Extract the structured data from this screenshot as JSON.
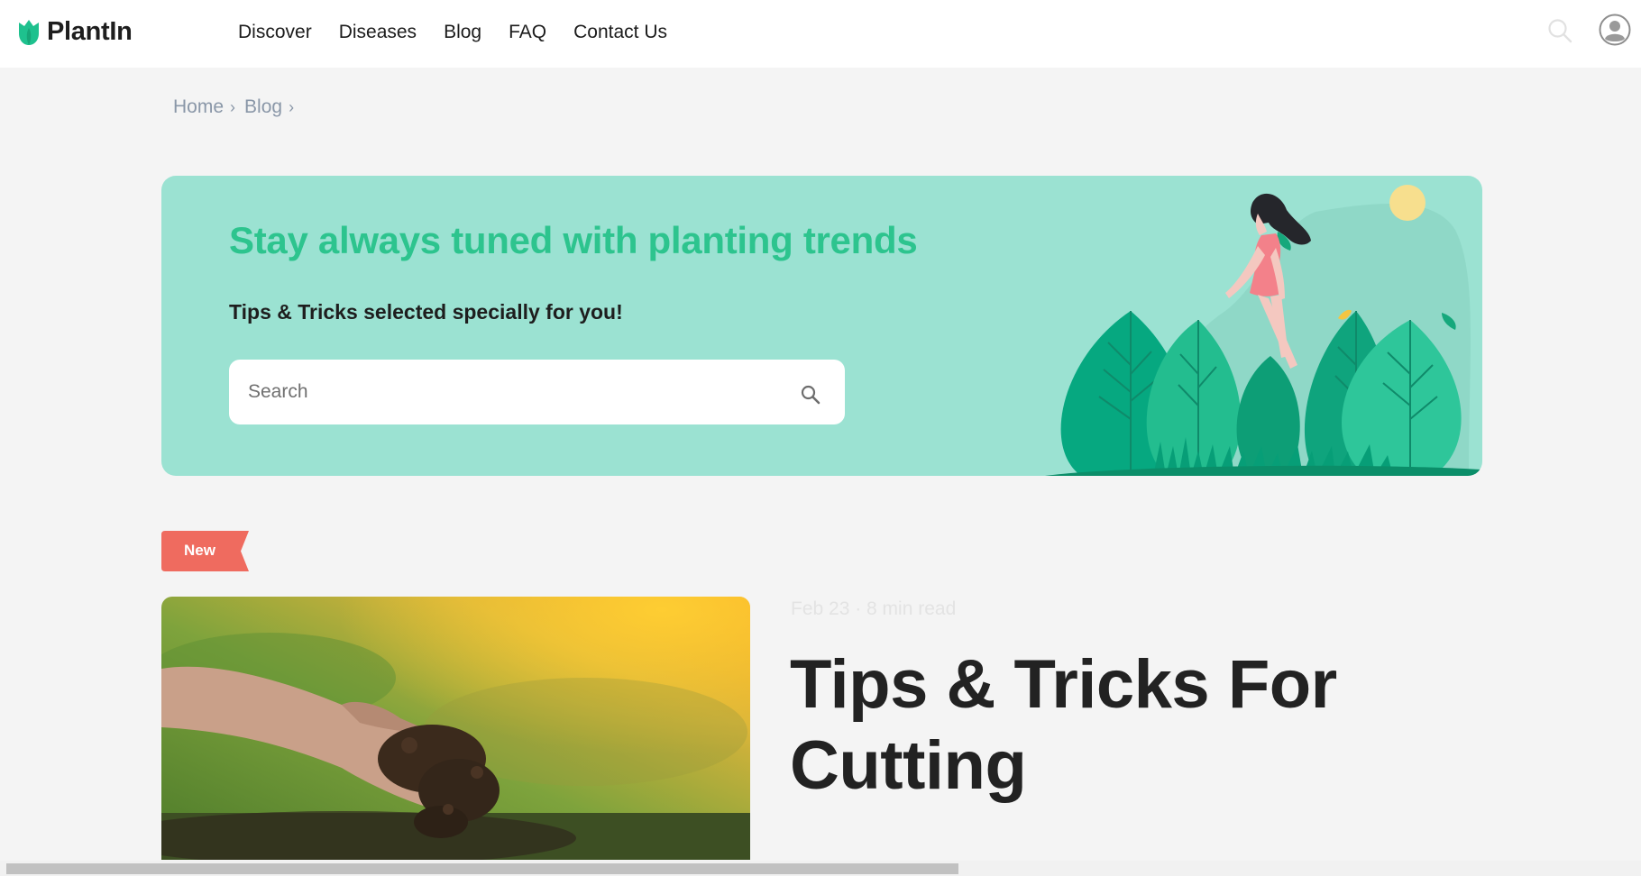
{
  "header": {
    "logo_text": "PlantIn",
    "nav": [
      "Discover",
      "Diseases",
      "Blog",
      "FAQ",
      "Contact Us"
    ],
    "brand_color": "#1ec18e",
    "icons": {
      "search": "search-icon",
      "account": "user-avatar-icon"
    }
  },
  "breadcrumb": [
    "Home",
    "Blog"
  ],
  "hero": {
    "title": "Stay always tuned with planting trends",
    "subtitle": "Tips & Tricks selected specially for you!",
    "search_placeholder": "Search",
    "search_value": "",
    "background_color": "#9be2d2",
    "title_color": "#2dc48e"
  },
  "featured": {
    "badge": "New",
    "badge_color": "#ef6b5f",
    "meta": "Feb 23 · 8 min read",
    "title": "Tips & Tricks For Cutting"
  }
}
